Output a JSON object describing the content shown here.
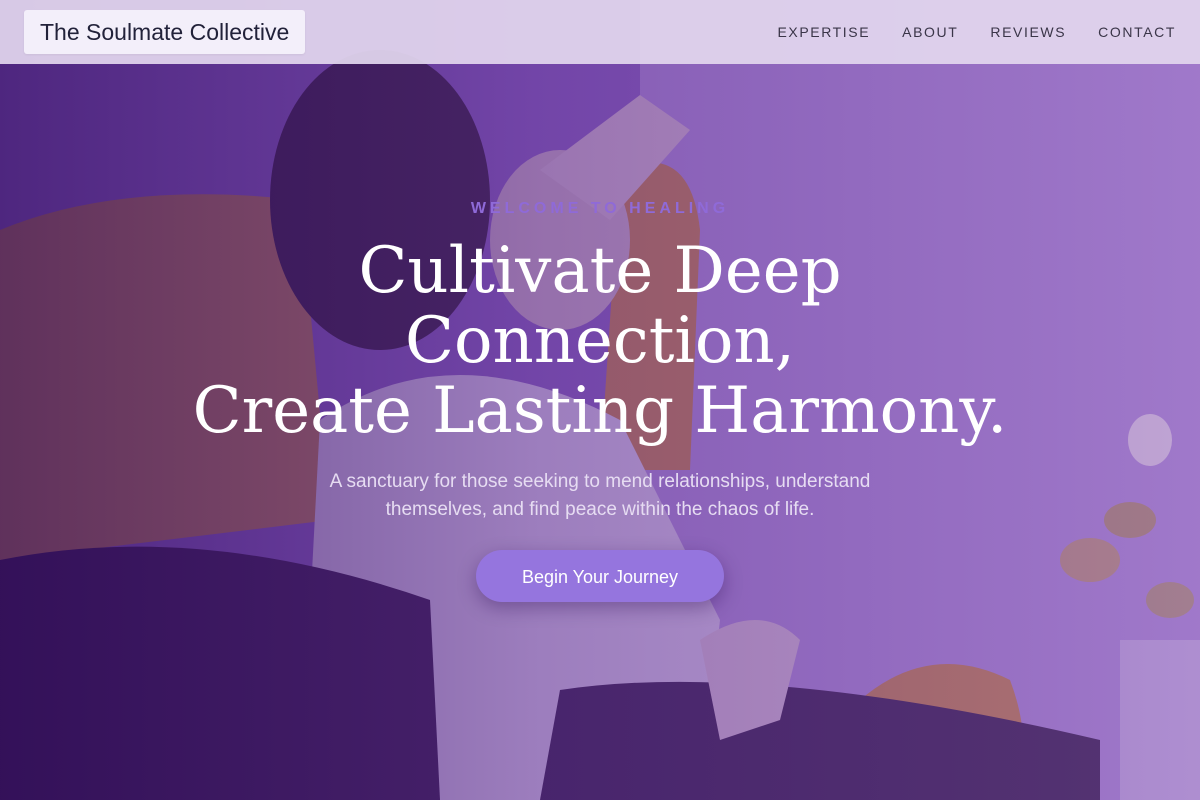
{
  "brand": {
    "name": "The Soulmate Collective"
  },
  "nav": {
    "items": [
      "EXPERTISE",
      "ABOUT",
      "REVIEWS",
      "CONTACT"
    ]
  },
  "hero": {
    "eyebrow": "WELCOME TO HEALING",
    "headline": [
      "Cultivate Deep",
      "Connection,",
      "Create Lasting Harmony."
    ],
    "subtext": "A sanctuary for those seeking to mend relationships, understand themselves, and find peace within the chaos of life.",
    "cta_label": "Begin Your Journey"
  },
  "colors": {
    "header_bg": "#e2d6ee",
    "eyebrow": "#8f6ad8",
    "cta_bg": "#9575de",
    "overlay": "#5b2d91"
  }
}
